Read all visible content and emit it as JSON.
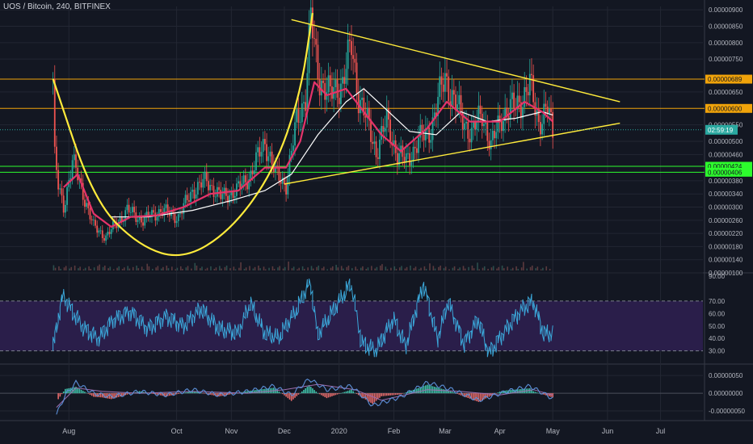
{
  "header": {
    "title": "UOS / Bitcoin, 240, BITFINEX"
  },
  "colors": {
    "background": "#131722",
    "grid": "#232733",
    "text": "#b2b5be",
    "candle_up": "#26a69a",
    "candle_down": "#ef5350",
    "ma_fast": "#e5336a",
    "ma_slow": "#ffffff",
    "trendline": "#ffeb3b",
    "resistance": "#f0a30a",
    "support": "#2dfc2d",
    "rsi": "#3ba7d9",
    "rsi_band": "#2a1e4a",
    "macd": "#5b8fd8",
    "macd_signal": "#9e6fb0",
    "current_price": "#2aa8a0"
  },
  "chart_data": [
    {
      "type": "candlestick",
      "title": "UOS / Bitcoin, 240, BITFINEX",
      "x_ticks": [
        "Aug",
        "Oct",
        "Nov",
        "Dec",
        "2020",
        "Feb",
        "Mar",
        "Apr",
        "May",
        "Jun",
        "Jul"
      ],
      "y_ticks": [
        "0.00000900",
        "0.00000850",
        "0.00000800",
        "0.00000750",
        "0.00000650",
        "0.00000550",
        "0.00000500",
        "0.00000460",
        "0.00000380",
        "0.00000340",
        "0.00000300",
        "0.00000260",
        "0.00000220",
        "0.00000180",
        "0.00000140",
        "0.00000100"
      ],
      "ylim": [
        1e-06,
        9.1e-06
      ],
      "price_path": [
        [
          "2019-07-23",
          6.9e-06
        ],
        [
          "2019-07-24",
          4.5e-06
        ],
        [
          "2019-07-26",
          3.6e-06
        ],
        [
          "2019-07-29",
          3e-06
        ],
        [
          "2019-08-03",
          4.4e-06
        ],
        [
          "2019-08-08",
          3.6e-06
        ],
        [
          "2019-08-15",
          2.4e-06
        ],
        [
          "2019-08-22",
          2.1e-06
        ],
        [
          "2019-08-28",
          2.5e-06
        ],
        [
          "2019-09-03",
          2.9e-06
        ],
        [
          "2019-09-12",
          2.6e-06
        ],
        [
          "2019-09-22",
          2.9e-06
        ],
        [
          "2019-10-02",
          2.7e-06
        ],
        [
          "2019-10-10",
          3.5e-06
        ],
        [
          "2019-10-18",
          3.8e-06
        ],
        [
          "2019-10-26",
          3.3e-06
        ],
        [
          "2019-11-04",
          3.5e-06
        ],
        [
          "2019-11-12",
          4e-06
        ],
        [
          "2019-11-20",
          5e-06
        ],
        [
          "2019-11-26",
          4e-06
        ],
        [
          "2019-12-02",
          3.7e-06
        ],
        [
          "2019-12-08",
          5.6e-06
        ],
        [
          "2019-12-13",
          6.4e-06
        ],
        [
          "2019-12-16",
          8.8e-06
        ],
        [
          "2019-12-18",
          7.8e-06
        ],
        [
          "2019-12-21",
          6.9e-06
        ],
        [
          "2019-12-27",
          6.4e-06
        ],
        [
          "2020-01-03",
          6.8e-06
        ],
        [
          "2020-01-08",
          7.9e-06
        ],
        [
          "2020-01-12",
          6.4e-06
        ],
        [
          "2020-01-18",
          5.4e-06
        ],
        [
          "2020-01-22",
          4.7e-06
        ],
        [
          "2020-01-28",
          5.6e-06
        ],
        [
          "2020-02-03",
          4.6e-06
        ],
        [
          "2020-02-08",
          4.4e-06
        ],
        [
          "2020-02-15",
          5e-06
        ],
        [
          "2020-02-22",
          5.4e-06
        ],
        [
          "2020-03-01",
          7e-06
        ],
        [
          "2020-03-06",
          6.2e-06
        ],
        [
          "2020-03-12",
          5.6e-06
        ],
        [
          "2020-03-16",
          5.2e-06
        ],
        [
          "2020-03-22",
          5.9e-06
        ],
        [
          "2020-03-27",
          4.8e-06
        ],
        [
          "2020-04-02",
          5.8e-06
        ],
        [
          "2020-04-08",
          6e-06
        ],
        [
          "2020-04-14",
          6.3e-06
        ],
        [
          "2020-04-18",
          6.7e-06
        ],
        [
          "2020-04-23",
          5.6e-06
        ],
        [
          "2020-04-28",
          6e-06
        ],
        [
          "2020-05-01",
          5.2e-06
        ]
      ],
      "ma_fast_path": [
        [
          "2019-07-29",
          3.6e-06
        ],
        [
          "2019-08-06",
          4e-06
        ],
        [
          "2019-08-15",
          2.8e-06
        ],
        [
          "2019-08-25",
          2.4e-06
        ],
        [
          "2019-09-05",
          2.7e-06
        ],
        [
          "2019-09-20",
          2.75e-06
        ],
        [
          "2019-10-05",
          3e-06
        ],
        [
          "2019-10-20",
          3.4e-06
        ],
        [
          "2019-11-05",
          3.5e-06
        ],
        [
          "2019-11-20",
          4.2e-06
        ],
        [
          "2019-12-02",
          4.2e-06
        ],
        [
          "2019-12-10",
          5e-06
        ],
        [
          "2019-12-18",
          6.8e-06
        ],
        [
          "2019-12-25",
          6.4e-06
        ],
        [
          "2020-01-05",
          6.6e-06
        ],
        [
          "2020-01-15",
          5.9e-06
        ],
        [
          "2020-01-25",
          5.2e-06
        ],
        [
          "2020-02-05",
          4.7e-06
        ],
        [
          "2020-02-20",
          5.4e-06
        ],
        [
          "2020-03-02",
          6.2e-06
        ],
        [
          "2020-03-15",
          5.6e-06
        ],
        [
          "2020-04-01",
          5.6e-06
        ],
        [
          "2020-04-15",
          6.2e-06
        ],
        [
          "2020-04-25",
          5.9e-06
        ],
        [
          "2020-05-01",
          5.6e-06
        ]
      ],
      "ma_slow_path": [
        [
          "2019-08-25",
          2.7e-06
        ],
        [
          "2019-09-15",
          2.7e-06
        ],
        [
          "2019-10-10",
          2.9e-06
        ],
        [
          "2019-11-01",
          3.2e-06
        ],
        [
          "2019-11-20",
          3.5e-06
        ],
        [
          "2019-12-05",
          4e-06
        ],
        [
          "2019-12-20",
          5.2e-06
        ],
        [
          "2020-01-05",
          6.2e-06
        ],
        [
          "2020-01-15",
          6.6e-06
        ],
        [
          "2020-01-25",
          6.1e-06
        ],
        [
          "2020-02-10",
          5.3e-06
        ],
        [
          "2020-02-25",
          5.2e-06
        ],
        [
          "2020-03-10",
          5.9e-06
        ],
        [
          "2020-03-25",
          5.6e-06
        ],
        [
          "2020-04-10",
          5.7e-06
        ],
        [
          "2020-04-25",
          5.9e-06
        ],
        [
          "2020-05-01",
          5.8e-06
        ]
      ],
      "trendlines": [
        {
          "name": "cup",
          "points": [
            [
              "2019-07-23",
              6.9e-06
            ],
            [
              "2019-08-15",
              3.2e-06
            ],
            [
              "2019-09-10",
              1.8e-06
            ],
            [
              "2019-10-05",
              1.4e-06
            ],
            [
              "2019-11-01",
              2.3e-06
            ],
            [
              "2019-11-25",
              4.1e-06
            ],
            [
              "2019-12-10",
              6.4e-06
            ],
            [
              "2019-12-17",
              8.9e-06
            ]
          ]
        },
        {
          "name": "upper",
          "points": [
            [
              "2019-12-05",
              8.7e-06
            ],
            [
              "2020-06-08",
              6.2e-06
            ]
          ]
        },
        {
          "name": "lower",
          "points": [
            [
              "2019-12-01",
              3.7e-06
            ],
            [
              "2020-06-08",
              5.55e-06
            ]
          ]
        }
      ],
      "price_lines": [
        {
          "label": "0.00000689",
          "value": 6.89e-06,
          "kind": "resistance"
        },
        {
          "label": "0.00000600",
          "value": 6e-06,
          "kind": "resistance"
        },
        {
          "label": "0.00000424",
          "value": 4.24e-06,
          "kind": "support"
        },
        {
          "label": "0.00000406",
          "value": 4.06e-06,
          "kind": "support"
        }
      ],
      "current_price": {
        "value": 5.35e-06,
        "countdown": "02:59:19"
      }
    },
    {
      "type": "line",
      "title": "",
      "y_ticks": [
        "90.00",
        "70.00",
        "60.00",
        "50.00",
        "40.00",
        "30.00"
      ],
      "ylim": [
        20,
        92
      ],
      "band": [
        30,
        70
      ],
      "path": [
        [
          "2019-07-23",
          30
        ],
        [
          "2019-07-26",
          55
        ],
        [
          "2019-07-29",
          75
        ],
        [
          "2019-08-03",
          62
        ],
        [
          "2019-08-10",
          48
        ],
        [
          "2019-08-18",
          40
        ],
        [
          "2019-08-26",
          55
        ],
        [
          "2019-09-05",
          62
        ],
        [
          "2019-09-15",
          48
        ],
        [
          "2019-09-25",
          58
        ],
        [
          "2019-10-05",
          50
        ],
        [
          "2019-10-15",
          64
        ],
        [
          "2019-10-25",
          48
        ],
        [
          "2019-11-05",
          44
        ],
        [
          "2019-11-12",
          68
        ],
        [
          "2019-11-20",
          44
        ],
        [
          "2019-11-28",
          40
        ],
        [
          "2019-12-08",
          62
        ],
        [
          "2019-12-16",
          86
        ],
        [
          "2019-12-20",
          42
        ],
        [
          "2019-12-28",
          60
        ],
        [
          "2020-01-08",
          84
        ],
        [
          "2020-01-14",
          36
        ],
        [
          "2020-01-22",
          30
        ],
        [
          "2020-02-01",
          56
        ],
        [
          "2020-02-08",
          34
        ],
        [
          "2020-02-18",
          84
        ],
        [
          "2020-02-26",
          40
        ],
        [
          "2020-03-03",
          70
        ],
        [
          "2020-03-12",
          36
        ],
        [
          "2020-03-20",
          56
        ],
        [
          "2020-03-26",
          28
        ],
        [
          "2020-04-05",
          48
        ],
        [
          "2020-04-14",
          64
        ],
        [
          "2020-04-20",
          70
        ],
        [
          "2020-04-26",
          44
        ],
        [
          "2020-05-01",
          44
        ]
      ]
    },
    {
      "type": "line",
      "title": "",
      "y_ticks": [
        "0.00000050",
        "0.00000000",
        "-0.00000050"
      ],
      "ylim": [
        -7.5e-07,
        8e-07
      ],
      "macd_path": [
        [
          "2019-07-25",
          -6e-07
        ],
        [
          "2019-07-30",
          -5e-08
        ],
        [
          "2019-08-05",
          3e-07
        ],
        [
          "2019-08-15",
          0.0
        ],
        [
          "2019-08-25",
          -1e-07
        ],
        [
          "2019-09-10",
          5e-08
        ],
        [
          "2019-09-25",
          -5e-08
        ],
        [
          "2019-10-10",
          1e-07
        ],
        [
          "2019-10-25",
          -5e-08
        ],
        [
          "2019-11-10",
          5e-08
        ],
        [
          "2019-11-25",
          2e-07
        ],
        [
          "2019-12-05",
          -5e-08
        ],
        [
          "2019-12-15",
          4e-07
        ],
        [
          "2019-12-25",
          1e-07
        ],
        [
          "2020-01-08",
          2e-07
        ],
        [
          "2020-01-20",
          -3.5e-07
        ],
        [
          "2020-02-05",
          -1e-07
        ],
        [
          "2020-02-20",
          3e-07
        ],
        [
          "2020-03-05",
          1e-07
        ],
        [
          "2020-03-20",
          -2e-07
        ],
        [
          "2020-04-05",
          5e-08
        ],
        [
          "2020-04-18",
          2e-07
        ],
        [
          "2020-05-01",
          -1.5e-07
        ]
      ],
      "signal_path": [
        [
          "2019-07-25",
          -4e-07
        ],
        [
          "2019-08-05",
          1.5e-07
        ],
        [
          "2019-08-20",
          5e-08
        ],
        [
          "2019-09-10",
          0.0
        ],
        [
          "2019-10-10",
          5e-08
        ],
        [
          "2019-11-10",
          0.0
        ],
        [
          "2019-12-01",
          1e-07
        ],
        [
          "2019-12-20",
          2.5e-07
        ],
        [
          "2020-01-10",
          1e-07
        ],
        [
          "2020-01-25",
          -2e-07
        ],
        [
          "2020-02-20",
          1e-07
        ],
        [
          "2020-03-10",
          5e-08
        ],
        [
          "2020-04-01",
          -5e-08
        ],
        [
          "2020-04-20",
          1e-07
        ],
        [
          "2020-05-01",
          -5e-08
        ]
      ]
    }
  ]
}
